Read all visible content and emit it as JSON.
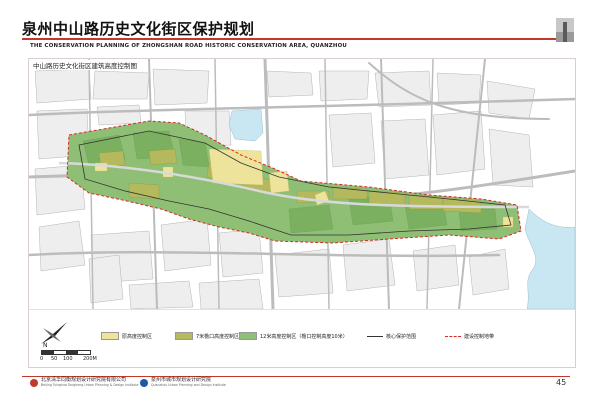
{
  "header": {
    "title": "泉州中山路历史文化街区保护规划",
    "subtitle": "THE CONSERVATION PLANNING OF ZHONGSHAN ROAD HISTORIC CONSERVATION AREA, QUANZHOU"
  },
  "map": {
    "caption": "中山路历史文化街区建筑高度控制图",
    "colors": {
      "background": "#ffffff",
      "block": "#eeeeee",
      "road": "#bcbcbc",
      "water": "#c9e7f2",
      "zone_green": "#8fbf74",
      "zone_olive": "#b3b95c",
      "zone_yellow": "#ede39a",
      "core_boundary": "#333333",
      "control_boundary": "#d62b2b"
    }
  },
  "legend": {
    "compass_letter": "N",
    "scale": {
      "labels": [
        "0",
        "50",
        "100",
        "200M"
      ]
    },
    "items": [
      {
        "label": "原高度控制区",
        "color": "#ede39a",
        "kind": "swatch"
      },
      {
        "label": "7米檐口高度控制区",
        "color": "#b3b95c",
        "kind": "swatch"
      },
      {
        "label": "12米高度控制区（檐口控制高度10米）",
        "color": "#8fbf74",
        "kind": "swatch"
      },
      {
        "label": "核心保护范围",
        "color": "#333333",
        "kind": "line-solid"
      },
      {
        "label": "建设控制地带",
        "color": "#d62b2b",
        "kind": "line-dashed"
      }
    ]
  },
  "footer": {
    "org_left": {
      "name": "北京清华同衡规划设计研究院有限公司",
      "en": "Beijing Tsinghua Tongheng Urban Planning & Design Institute"
    },
    "org_right": {
      "name": "泉州市城市规划设计研究院",
      "en": "Quanzhou Urban Planning and Design Institute"
    },
    "page_number": "45"
  }
}
